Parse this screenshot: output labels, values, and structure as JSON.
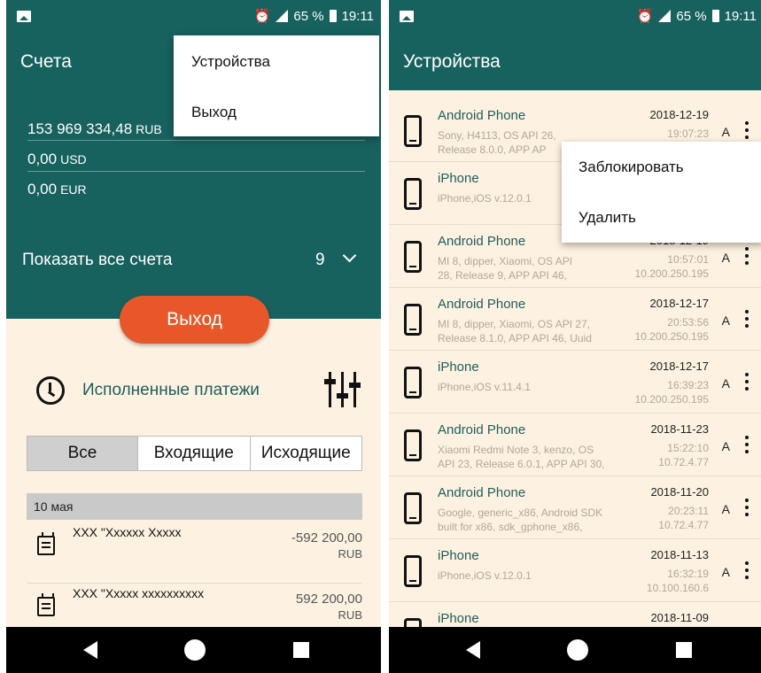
{
  "status_bar": {
    "network": "4G",
    "battery": "65 %",
    "time": "19:11"
  },
  "left": {
    "title": "Счета",
    "balances": [
      {
        "amount": "153 969 334,48",
        "currency": "RUB"
      },
      {
        "amount": "0,00",
        "currency": "USD"
      },
      {
        "amount": "0,00",
        "currency": "EUR"
      }
    ],
    "show_all_label": "Показать все счета",
    "accounts_count": "9",
    "exit_button": "Выход",
    "payments_title": "Исполненные платежи",
    "tabs": [
      "Все",
      "Входящие",
      "Исходящие"
    ],
    "active_tab": "Все",
    "date_header": "10 мая",
    "transactions": [
      {
        "name": "ХХХ \"Хххххх Ххххх",
        "amount": "-592 200,00",
        "currency": "RUB"
      },
      {
        "name": "ХХХ \"Ххххх хххххххххх",
        "amount": "592 200,00",
        "currency": "RUB"
      }
    ],
    "menu": [
      "Устройства",
      "Выход"
    ]
  },
  "right": {
    "title": "Устройства",
    "devices": [
      {
        "name": "Android Phone",
        "details": "Sony, H4113, OS API 26,\nRelease 8.0.0, APP AP",
        "date": "2018-12-19",
        "time": "19:07:23",
        "ip": "",
        "flag": "A"
      },
      {
        "name": "iPhone",
        "details": "iPhone,iOS v.12.0.1",
        "date": "",
        "time": "",
        "ip": "",
        "flag": ""
      },
      {
        "name": "Android Phone",
        "details": "MI 8, dipper, Xiaomi, OS API\n28, Release 9, APP API 46,",
        "date": "2018-12-19",
        "time": "10:57:01",
        "ip": "10.200.250.195",
        "flag": "A"
      },
      {
        "name": "Android Phone",
        "details": "MI 8, dipper, Xiaomi, OS API 27,\nRelease 8.1.0, APP API 46, Uuid",
        "date": "2018-12-17",
        "time": "20:53:56",
        "ip": "10.200.250.195",
        "flag": "A"
      },
      {
        "name": "iPhone",
        "details": "iPhone,iOS v.11.4.1",
        "date": "2018-12-17",
        "time": "16:39:23",
        "ip": "10.200.250.195",
        "flag": "A"
      },
      {
        "name": "Android Phone",
        "details": "Xiaomi Redmi Note 3, kenzo, OS\nAPI 23, Release 6.0.1, APP API 30,",
        "date": "2018-11-23",
        "time": "15:22:10",
        "ip": "10.72.4.77",
        "flag": "A"
      },
      {
        "name": "Android Phone",
        "details": "Google, generic_x86, Android SDK\nbuilt for x86, sdk_gphone_x86,",
        "date": "2018-11-20",
        "time": "20:23:11",
        "ip": "10.72.4.77",
        "flag": "A"
      },
      {
        "name": "iPhone",
        "details": "iPhone,iOS v.12.0.1",
        "date": "2018-11-13",
        "time": "16:32:19",
        "ip": "10.100.160.6",
        "flag": "A"
      },
      {
        "name": "iPhone",
        "details": "",
        "date": "2018-11-09",
        "time": "",
        "ip": "",
        "flag": ""
      }
    ],
    "menu": [
      "Заблокировать",
      "Удалить"
    ]
  },
  "colors": {
    "teal": "#17615e",
    "accent": "#e8572a",
    "background": "#fdf2e1"
  }
}
